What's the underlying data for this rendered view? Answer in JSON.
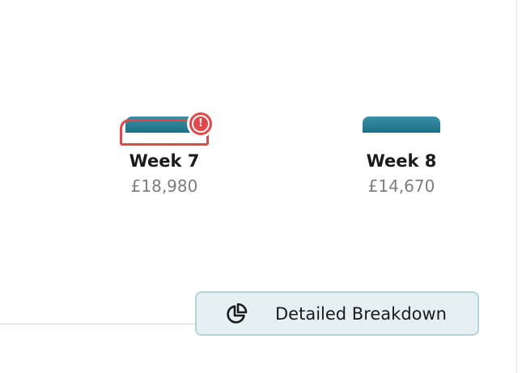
{
  "weeks": [
    {
      "label": "Week 7",
      "amount": "£18,980",
      "flagged": true,
      "alert_glyph": "!"
    },
    {
      "label": "Week 8",
      "amount": "£14,670",
      "flagged": false
    }
  ],
  "actions": {
    "breakdown_label": "Detailed Breakdown",
    "breakdown_icon": "pie-chart-icon"
  },
  "colors": {
    "bar": "#2a7f96",
    "alert": "#e0484a",
    "button_bg": "#e5f0f2",
    "button_border": "#b7d3d9",
    "amount_text": "#7d7d7d"
  }
}
